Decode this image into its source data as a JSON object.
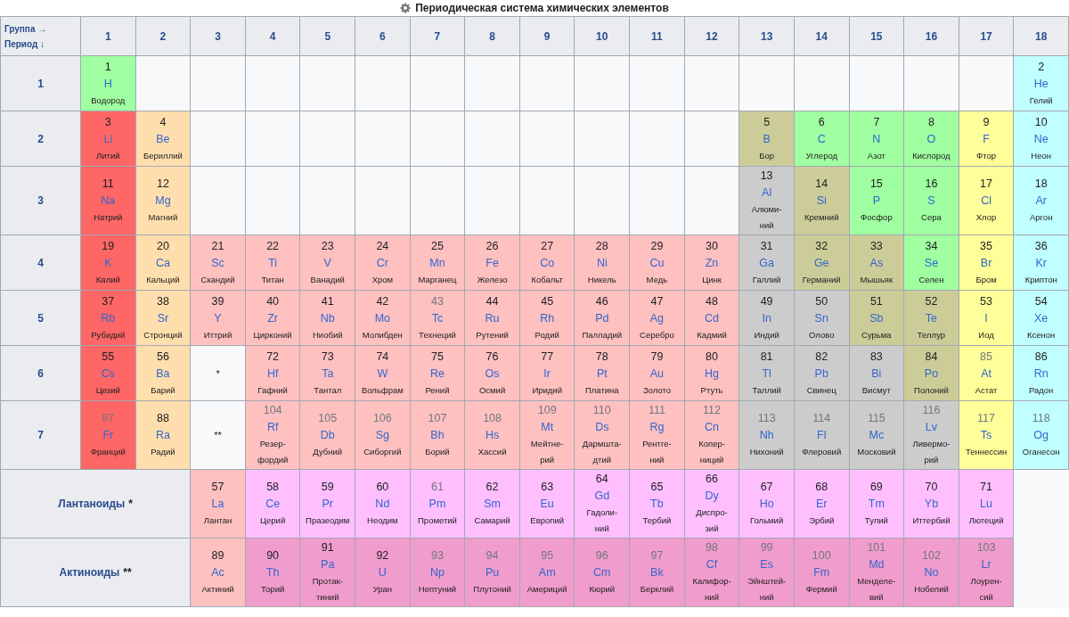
{
  "title": "Периодическая система химических элементов",
  "corner": {
    "group_label": "Группа →",
    "period_label": "Период ↓"
  },
  "groups": [
    "1",
    "2",
    "3",
    "4",
    "5",
    "6",
    "7",
    "8",
    "9",
    "10",
    "11",
    "12",
    "13",
    "14",
    "15",
    "16",
    "17",
    "18"
  ],
  "periods": [
    {
      "label": "1",
      "cells": [
        {
          "kind": "element",
          "number": "1",
          "symbol": "H",
          "name": "Водород",
          "color": "#a0ffa0",
          "faint": false
        },
        {
          "kind": "empty"
        },
        {
          "kind": "empty"
        },
        {
          "kind": "empty"
        },
        {
          "kind": "empty"
        },
        {
          "kind": "empty"
        },
        {
          "kind": "empty"
        },
        {
          "kind": "empty"
        },
        {
          "kind": "empty"
        },
        {
          "kind": "empty"
        },
        {
          "kind": "empty"
        },
        {
          "kind": "empty"
        },
        {
          "kind": "empty"
        },
        {
          "kind": "empty"
        },
        {
          "kind": "empty"
        },
        {
          "kind": "empty"
        },
        {
          "kind": "empty"
        },
        {
          "kind": "element",
          "number": "2",
          "symbol": "He",
          "name": "Гелий",
          "color": "#c0ffff",
          "faint": false
        }
      ]
    },
    {
      "label": "2",
      "cells": [
        {
          "kind": "element",
          "number": "3",
          "symbol": "Li",
          "name": "Литий",
          "color": "#ff6666",
          "faint": false
        },
        {
          "kind": "element",
          "number": "4",
          "symbol": "Be",
          "name": "Бериллий",
          "color": "#ffdead",
          "faint": false
        },
        {
          "kind": "empty"
        },
        {
          "kind": "empty"
        },
        {
          "kind": "empty"
        },
        {
          "kind": "empty"
        },
        {
          "kind": "empty"
        },
        {
          "kind": "empty"
        },
        {
          "kind": "empty"
        },
        {
          "kind": "empty"
        },
        {
          "kind": "empty"
        },
        {
          "kind": "empty"
        },
        {
          "kind": "element",
          "number": "5",
          "symbol": "B",
          "name": "Бор",
          "color": "#cccc99",
          "faint": false
        },
        {
          "kind": "element",
          "number": "6",
          "symbol": "C",
          "name": "Углерод",
          "color": "#a0ffa0",
          "faint": false
        },
        {
          "kind": "element",
          "number": "7",
          "symbol": "N",
          "name": "Азот",
          "color": "#a0ffa0",
          "faint": false
        },
        {
          "kind": "element",
          "number": "8",
          "symbol": "O",
          "name": "Кислород",
          "color": "#a0ffa0",
          "faint": false
        },
        {
          "kind": "element",
          "number": "9",
          "symbol": "F",
          "name": "Фтор",
          "color": "#ffff99",
          "faint": false
        },
        {
          "kind": "element",
          "number": "10",
          "symbol": "Ne",
          "name": "Неон",
          "color": "#c0ffff",
          "faint": false
        }
      ]
    },
    {
      "label": "3",
      "cells": [
        {
          "kind": "element",
          "number": "11",
          "symbol": "Na",
          "name": "Натрий",
          "color": "#ff6666",
          "faint": false
        },
        {
          "kind": "element",
          "number": "12",
          "symbol": "Mg",
          "name": "Магний",
          "color": "#ffdead",
          "faint": false
        },
        {
          "kind": "empty"
        },
        {
          "kind": "empty"
        },
        {
          "kind": "empty"
        },
        {
          "kind": "empty"
        },
        {
          "kind": "empty"
        },
        {
          "kind": "empty"
        },
        {
          "kind": "empty"
        },
        {
          "kind": "empty"
        },
        {
          "kind": "empty"
        },
        {
          "kind": "empty"
        },
        {
          "kind": "element",
          "number": "13",
          "symbol": "Al",
          "name": "Алюми-\nний",
          "color": "#cccccc",
          "faint": false
        },
        {
          "kind": "element",
          "number": "14",
          "symbol": "Si",
          "name": "Кремний",
          "color": "#cccc99",
          "faint": false
        },
        {
          "kind": "element",
          "number": "15",
          "symbol": "P",
          "name": "Фосфор",
          "color": "#a0ffa0",
          "faint": false
        },
        {
          "kind": "element",
          "number": "16",
          "symbol": "S",
          "name": "Сера",
          "color": "#a0ffa0",
          "faint": false
        },
        {
          "kind": "element",
          "number": "17",
          "symbol": "Cl",
          "name": "Хлор",
          "color": "#ffff99",
          "faint": false
        },
        {
          "kind": "element",
          "number": "18",
          "symbol": "Ar",
          "name": "Аргон",
          "color": "#c0ffff",
          "faint": false
        }
      ]
    },
    {
      "label": "4",
      "cells": [
        {
          "kind": "element",
          "number": "19",
          "symbol": "K",
          "name": "Калий",
          "color": "#ff6666",
          "faint": false
        },
        {
          "kind": "element",
          "number": "20",
          "symbol": "Ca",
          "name": "Кальций",
          "color": "#ffdead",
          "faint": false
        },
        {
          "kind": "element",
          "number": "21",
          "symbol": "Sc",
          "name": "Скандий",
          "color": "#ffc0c0",
          "faint": false
        },
        {
          "kind": "element",
          "number": "22",
          "symbol": "Ti",
          "name": "Титан",
          "color": "#ffc0c0",
          "faint": false
        },
        {
          "kind": "element",
          "number": "23",
          "symbol": "V",
          "name": "Ванадий",
          "color": "#ffc0c0",
          "faint": false
        },
        {
          "kind": "element",
          "number": "24",
          "symbol": "Cr",
          "name": "Хром",
          "color": "#ffc0c0",
          "faint": false
        },
        {
          "kind": "element",
          "number": "25",
          "symbol": "Mn",
          "name": "Марганец",
          "color": "#ffc0c0",
          "faint": false
        },
        {
          "kind": "element",
          "number": "26",
          "symbol": "Fe",
          "name": "Железо",
          "color": "#ffc0c0",
          "faint": false
        },
        {
          "kind": "element",
          "number": "27",
          "symbol": "Co",
          "name": "Кобальт",
          "color": "#ffc0c0",
          "faint": false
        },
        {
          "kind": "element",
          "number": "28",
          "symbol": "Ni",
          "name": "Никель",
          "color": "#ffc0c0",
          "faint": false
        },
        {
          "kind": "element",
          "number": "29",
          "symbol": "Cu",
          "name": "Медь",
          "color": "#ffc0c0",
          "faint": false
        },
        {
          "kind": "element",
          "number": "30",
          "symbol": "Zn",
          "name": "Цинк",
          "color": "#ffc0c0",
          "faint": false
        },
        {
          "kind": "element",
          "number": "31",
          "symbol": "Ga",
          "name": "Галлий",
          "color": "#cccccc",
          "faint": false
        },
        {
          "kind": "element",
          "number": "32",
          "symbol": "Ge",
          "name": "Германий",
          "color": "#cccc99",
          "faint": false
        },
        {
          "kind": "element",
          "number": "33",
          "symbol": "As",
          "name": "Мышьяк",
          "color": "#cccc99",
          "faint": false
        },
        {
          "kind": "element",
          "number": "34",
          "symbol": "Se",
          "name": "Селен",
          "color": "#a0ffa0",
          "faint": false
        },
        {
          "kind": "element",
          "number": "35",
          "symbol": "Br",
          "name": "Бром",
          "color": "#ffff99",
          "faint": false
        },
        {
          "kind": "element",
          "number": "36",
          "symbol": "Kr",
          "name": "Криптон",
          "color": "#c0ffff",
          "faint": false
        }
      ]
    },
    {
      "label": "5",
      "cells": [
        {
          "kind": "element",
          "number": "37",
          "symbol": "Rb",
          "name": "Рубидий",
          "color": "#ff6666",
          "faint": false
        },
        {
          "kind": "element",
          "number": "38",
          "symbol": "Sr",
          "name": "Стронций",
          "color": "#ffdead",
          "faint": false
        },
        {
          "kind": "element",
          "number": "39",
          "symbol": "Y",
          "name": "Иттрий",
          "color": "#ffc0c0",
          "faint": false
        },
        {
          "kind": "element",
          "number": "40",
          "symbol": "Zr",
          "name": "Цирконий",
          "color": "#ffc0c0",
          "faint": false
        },
        {
          "kind": "element",
          "number": "41",
          "symbol": "Nb",
          "name": "Ниобий",
          "color": "#ffc0c0",
          "faint": false
        },
        {
          "kind": "element",
          "number": "42",
          "symbol": "Mo",
          "name": "Молибден",
          "color": "#ffc0c0",
          "faint": false
        },
        {
          "kind": "element",
          "number": "43",
          "symbol": "Tc",
          "name": "Технеций",
          "color": "#ffc0c0",
          "faint": true
        },
        {
          "kind": "element",
          "number": "44",
          "symbol": "Ru",
          "name": "Рутений",
          "color": "#ffc0c0",
          "faint": false
        },
        {
          "kind": "element",
          "number": "45",
          "symbol": "Rh",
          "name": "Родий",
          "color": "#ffc0c0",
          "faint": false
        },
        {
          "kind": "element",
          "number": "46",
          "symbol": "Pd",
          "name": "Палладий",
          "color": "#ffc0c0",
          "faint": false
        },
        {
          "kind": "element",
          "number": "47",
          "symbol": "Ag",
          "name": "Серебро",
          "color": "#ffc0c0",
          "faint": false
        },
        {
          "kind": "element",
          "number": "48",
          "symbol": "Cd",
          "name": "Кадмий",
          "color": "#ffc0c0",
          "faint": false
        },
        {
          "kind": "element",
          "number": "49",
          "symbol": "In",
          "name": "Индий",
          "color": "#cccccc",
          "faint": false
        },
        {
          "kind": "element",
          "number": "50",
          "symbol": "Sn",
          "name": "Олово",
          "color": "#cccccc",
          "faint": false
        },
        {
          "kind": "element",
          "number": "51",
          "symbol": "Sb",
          "name": "Сурьма",
          "color": "#cccc99",
          "faint": false
        },
        {
          "kind": "element",
          "number": "52",
          "symbol": "Te",
          "name": "Теллур",
          "color": "#cccc99",
          "faint": false
        },
        {
          "kind": "element",
          "number": "53",
          "symbol": "I",
          "name": "Иод",
          "color": "#ffff99",
          "faint": false
        },
        {
          "kind": "element",
          "number": "54",
          "symbol": "Xe",
          "name": "Ксенон",
          "color": "#c0ffff",
          "faint": false
        }
      ]
    },
    {
      "label": "6",
      "cells": [
        {
          "kind": "element",
          "number": "55",
          "symbol": "Cs",
          "name": "Цезий",
          "color": "#ff6666",
          "faint": false
        },
        {
          "kind": "element",
          "number": "56",
          "symbol": "Ba",
          "name": "Барий",
          "color": "#ffdead",
          "faint": false
        },
        {
          "kind": "marker",
          "text": "*"
        },
        {
          "kind": "element",
          "number": "72",
          "symbol": "Hf",
          "name": "Гафний",
          "color": "#ffc0c0",
          "faint": false
        },
        {
          "kind": "element",
          "number": "73",
          "symbol": "Ta",
          "name": "Тантал",
          "color": "#ffc0c0",
          "faint": false
        },
        {
          "kind": "element",
          "number": "74",
          "symbol": "W",
          "name": "Вольфрам",
          "color": "#ffc0c0",
          "faint": false
        },
        {
          "kind": "element",
          "number": "75",
          "symbol": "Re",
          "name": "Рений",
          "color": "#ffc0c0",
          "faint": false
        },
        {
          "kind": "element",
          "number": "76",
          "symbol": "Os",
          "name": "Осмий",
          "color": "#ffc0c0",
          "faint": false
        },
        {
          "kind": "element",
          "number": "77",
          "symbol": "Ir",
          "name": "Иридий",
          "color": "#ffc0c0",
          "faint": false
        },
        {
          "kind": "element",
          "number": "78",
          "symbol": "Pt",
          "name": "Платина",
          "color": "#ffc0c0",
          "faint": false
        },
        {
          "kind": "element",
          "number": "79",
          "symbol": "Au",
          "name": "Золото",
          "color": "#ffc0c0",
          "faint": false
        },
        {
          "kind": "element",
          "number": "80",
          "symbol": "Hg",
          "name": "Ртуть",
          "color": "#ffc0c0",
          "faint": false
        },
        {
          "kind": "element",
          "number": "81",
          "symbol": "Tl",
          "name": "Таллий",
          "color": "#cccccc",
          "faint": false
        },
        {
          "kind": "element",
          "number": "82",
          "symbol": "Pb",
          "name": "Свинец",
          "color": "#cccccc",
          "faint": false
        },
        {
          "kind": "element",
          "number": "83",
          "symbol": "Bi",
          "name": "Висмут",
          "color": "#cccccc",
          "faint": false
        },
        {
          "kind": "element",
          "number": "84",
          "symbol": "Po",
          "name": "Полоний",
          "color": "#cccc99",
          "faint": false
        },
        {
          "kind": "element",
          "number": "85",
          "symbol": "At",
          "name": "Астат",
          "color": "#ffff99",
          "faint": true
        },
        {
          "kind": "element",
          "number": "86",
          "symbol": "Rn",
          "name": "Радон",
          "color": "#c0ffff",
          "faint": false
        }
      ]
    },
    {
      "label": "7",
      "cells": [
        {
          "kind": "element",
          "number": "87",
          "symbol": "Fr",
          "name": "Франций",
          "color": "#ff6666",
          "faint": true
        },
        {
          "kind": "element",
          "number": "88",
          "symbol": "Ra",
          "name": "Радий",
          "color": "#ffdead",
          "faint": false
        },
        {
          "kind": "marker",
          "text": "**"
        },
        {
          "kind": "element",
          "number": "104",
          "symbol": "Rf",
          "name": "Резер-\nфордий",
          "color": "#ffc0c0",
          "faint": true
        },
        {
          "kind": "element",
          "number": "105",
          "symbol": "Db",
          "name": "Дубний",
          "color": "#ffc0c0",
          "faint": true
        },
        {
          "kind": "element",
          "number": "106",
          "symbol": "Sg",
          "name": "Сиборгий",
          "color": "#ffc0c0",
          "faint": true
        },
        {
          "kind": "element",
          "number": "107",
          "symbol": "Bh",
          "name": "Борий",
          "color": "#ffc0c0",
          "faint": true
        },
        {
          "kind": "element",
          "number": "108",
          "symbol": "Hs",
          "name": "Хассий",
          "color": "#ffc0c0",
          "faint": true
        },
        {
          "kind": "element",
          "number": "109",
          "symbol": "Mt",
          "name": "Мейтне-\nрий",
          "color": "#ffc0c0",
          "faint": true
        },
        {
          "kind": "element",
          "number": "110",
          "symbol": "Ds",
          "name": "Дармшта-\nдтий",
          "color": "#ffc0c0",
          "faint": true
        },
        {
          "kind": "element",
          "number": "111",
          "symbol": "Rg",
          "name": "Рентге-\nний",
          "color": "#ffc0c0",
          "faint": true
        },
        {
          "kind": "element",
          "number": "112",
          "symbol": "Cn",
          "name": "Копер-\nниций",
          "color": "#ffc0c0",
          "faint": true
        },
        {
          "kind": "element",
          "number": "113",
          "symbol": "Nh",
          "name": "Нихоний",
          "color": "#cccccc",
          "faint": true
        },
        {
          "kind": "element",
          "number": "114",
          "symbol": "Fl",
          "name": "Флеровий",
          "color": "#cccccc",
          "faint": true
        },
        {
          "kind": "element",
          "number": "115",
          "symbol": "Mc",
          "name": "Московий",
          "color": "#cccccc",
          "faint": true
        },
        {
          "kind": "element",
          "number": "116",
          "symbol": "Lv",
          "name": "Ливермо-\nрий",
          "color": "#cccccc",
          "faint": true
        },
        {
          "kind": "element",
          "number": "117",
          "symbol": "Ts",
          "name": "Теннессин",
          "color": "#ffff99",
          "faint": true
        },
        {
          "kind": "element",
          "number": "118",
          "symbol": "Og",
          "name": "Оганесон",
          "color": "#c0ffff",
          "faint": true
        }
      ]
    }
  ],
  "series": [
    {
      "label": "Лантаноиды",
      "marker": "*",
      "cells": [
        {
          "kind": "element",
          "number": "57",
          "symbol": "La",
          "name": "Лантан",
          "color": "#ffc0c0",
          "faint": false
        },
        {
          "kind": "element",
          "number": "58",
          "symbol": "Ce",
          "name": "Церий",
          "color": "#ffbfff",
          "faint": false
        },
        {
          "kind": "element",
          "number": "59",
          "symbol": "Pr",
          "name": "Празеодим",
          "color": "#ffbfff",
          "faint": false
        },
        {
          "kind": "element",
          "number": "60",
          "symbol": "Nd",
          "name": "Неодим",
          "color": "#ffbfff",
          "faint": false
        },
        {
          "kind": "element",
          "number": "61",
          "symbol": "Pm",
          "name": "Прометий",
          "color": "#ffbfff",
          "faint": true
        },
        {
          "kind": "element",
          "number": "62",
          "symbol": "Sm",
          "name": "Самарий",
          "color": "#ffbfff",
          "faint": false
        },
        {
          "kind": "element",
          "number": "63",
          "symbol": "Eu",
          "name": "Европий",
          "color": "#ffbfff",
          "faint": false
        },
        {
          "kind": "element",
          "number": "64",
          "symbol": "Gd",
          "name": "Гадоли-\nний",
          "color": "#ffbfff",
          "faint": false
        },
        {
          "kind": "element",
          "number": "65",
          "symbol": "Tb",
          "name": "Тербий",
          "color": "#ffbfff",
          "faint": false
        },
        {
          "kind": "element",
          "number": "66",
          "symbol": "Dy",
          "name": "Диспро-\nзий",
          "color": "#ffbfff",
          "faint": false
        },
        {
          "kind": "element",
          "number": "67",
          "symbol": "Ho",
          "name": "Гольмий",
          "color": "#ffbfff",
          "faint": false
        },
        {
          "kind": "element",
          "number": "68",
          "symbol": "Er",
          "name": "Эрбий",
          "color": "#ffbfff",
          "faint": false
        },
        {
          "kind": "element",
          "number": "69",
          "symbol": "Tm",
          "name": "Тулий",
          "color": "#ffbfff",
          "faint": false
        },
        {
          "kind": "element",
          "number": "70",
          "symbol": "Yb",
          "name": "Иттербий",
          "color": "#ffbfff",
          "faint": false
        },
        {
          "kind": "element",
          "number": "71",
          "symbol": "Lu",
          "name": "Лютеций",
          "color": "#ffbfff",
          "faint": false
        }
      ]
    },
    {
      "label": "Актиноиды",
      "marker": "**",
      "cells": [
        {
          "kind": "element",
          "number": "89",
          "symbol": "Ac",
          "name": "Актиний",
          "color": "#ffc0c0",
          "faint": false
        },
        {
          "kind": "element",
          "number": "90",
          "symbol": "Th",
          "name": "Торий",
          "color": "#f09ccc",
          "faint": false
        },
        {
          "kind": "element",
          "number": "91",
          "symbol": "Pa",
          "name": "Протак-\nтиний",
          "color": "#f09ccc",
          "faint": false
        },
        {
          "kind": "element",
          "number": "92",
          "symbol": "U",
          "name": "Уран",
          "color": "#f09ccc",
          "faint": false
        },
        {
          "kind": "element",
          "number": "93",
          "symbol": "Np",
          "name": "Нептуний",
          "color": "#f09ccc",
          "faint": true
        },
        {
          "kind": "element",
          "number": "94",
          "symbol": "Pu",
          "name": "Плутоний",
          "color": "#f09ccc",
          "faint": true
        },
        {
          "kind": "element",
          "number": "95",
          "symbol": "Am",
          "name": "Америций",
          "color": "#f09ccc",
          "faint": true
        },
        {
          "kind": "element",
          "number": "96",
          "symbol": "Cm",
          "name": "Кюрий",
          "color": "#f09ccc",
          "faint": true
        },
        {
          "kind": "element",
          "number": "97",
          "symbol": "Bk",
          "name": "Берклий",
          "color": "#f09ccc",
          "faint": true
        },
        {
          "kind": "element",
          "number": "98",
          "symbol": "Cf",
          "name": "Калифор-\nний",
          "color": "#f09ccc",
          "faint": true
        },
        {
          "kind": "element",
          "number": "99",
          "symbol": "Es",
          "name": "Эйнштей-\nний",
          "color": "#f09ccc",
          "faint": true
        },
        {
          "kind": "element",
          "number": "100",
          "symbol": "Fm",
          "name": "Фермий",
          "color": "#f09ccc",
          "faint": true
        },
        {
          "kind": "element",
          "number": "101",
          "symbol": "Md",
          "name": "Менделе-\nвий",
          "color": "#f09ccc",
          "faint": true
        },
        {
          "kind": "element",
          "number": "102",
          "symbol": "No",
          "name": "Нобелий",
          "color": "#f09ccc",
          "faint": true
        },
        {
          "kind": "element",
          "number": "103",
          "symbol": "Lr",
          "name": "Лоурен-\nсий",
          "color": "#f09ccc",
          "faint": true
        }
      ]
    }
  ]
}
